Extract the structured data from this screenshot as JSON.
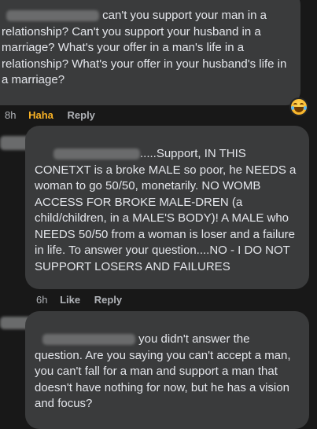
{
  "comments": [
    {
      "text": "can't you support your man in a relationship? Can't you support your husband in a marriage? What's your offer in a man's life in a relationship? What's your offer in your husband's life in a marriage?",
      "time": "8h",
      "reaction": "Haha",
      "reply": "Reply",
      "reaction_icon": "haha-emoji-icon"
    },
    {
      "text": ".....Support, IN THIS CONETXT is a broke MALE so poor, he NEEDS a woman to go 50/50, monetarily. NO WOMB ACCESS FOR BROKE MALE-DREN (a child/children, in a MALE'S BODY)! A MALE who NEEDS 50/50 from a woman is loser and a failure in life. To answer your question....NO - I DO NOT SUPPORT LOSERS AND FAILURES",
      "time": "6h",
      "like": "Like",
      "reply": "Reply"
    },
    {
      "text": "you didn't answer the question. Are you saying you can't accept a man, you can't fall for a man and support a man that doesn't have nothing for now, but he has a vision and focus?"
    }
  ],
  "colors": {
    "background": "#181818",
    "bubble": "#3a3b3c",
    "text": "#e4e6eb",
    "meta": "#b0b3b8",
    "haha": "#f7b125"
  }
}
